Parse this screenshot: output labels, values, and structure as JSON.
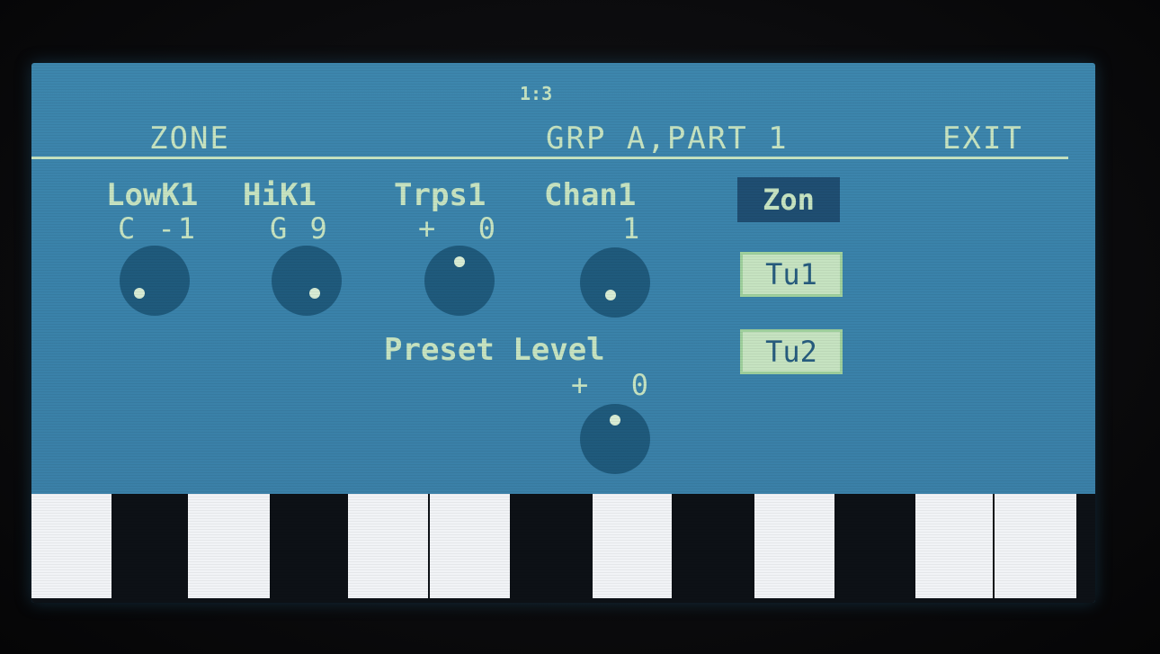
{
  "header": {
    "indicator": "1:3",
    "left_label": "ZONE",
    "center_label": "GRP A,PART 1",
    "right_label": "EXIT"
  },
  "params": [
    {
      "label": "LowK1",
      "value": "C -1"
    },
    {
      "label": "HiK1",
      "value": "G 9"
    },
    {
      "label": "Trps1",
      "value": "+  0"
    },
    {
      "label": "Chan1",
      "value": "1"
    }
  ],
  "preset_level": {
    "label": "Preset Level",
    "value": "+  0"
  },
  "buttons": [
    {
      "label": "Zon",
      "active": true
    },
    {
      "label": "Tu1",
      "active": false
    },
    {
      "label": "Tu2",
      "active": false
    }
  ],
  "colors": {
    "screen_bg": "#3b82aa",
    "lcd_text": "#c6e3c1",
    "knob": "#1f5a7c",
    "active_button": "#1f4e72",
    "white_key": "#f1f3f6",
    "black_key": "#0d1116"
  },
  "keyboard": {
    "white_keys": 9
  }
}
